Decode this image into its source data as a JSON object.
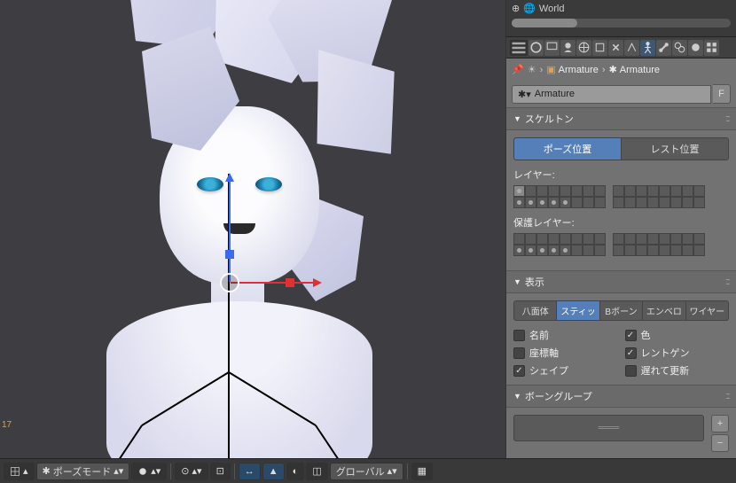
{
  "outliner": {
    "world": "World"
  },
  "breadcrumb": {
    "armature1": "Armature",
    "armature2": "Armature"
  },
  "datablock": {
    "name": "Armature",
    "fake_user": "F"
  },
  "panels": {
    "skeleton": {
      "title": "スケルトン",
      "pose_position": "ポーズ位置",
      "rest_position": "レスト位置",
      "layers_label": "レイヤー:",
      "protected_label": "保護レイヤー:"
    },
    "display": {
      "title": "表示",
      "octahedral": "八面体",
      "stick": "スティッ",
      "bbone": "Bボーン",
      "envelope": "エンベロ",
      "wire": "ワイヤー",
      "names": "名前",
      "colors": "色",
      "axes": "座標軸",
      "xray": "レントゲン",
      "shapes": "シェイプ",
      "delay": "遅れて更新"
    },
    "bonegroups": {
      "title": "ボーングループ",
      "placeholder": "═══"
    }
  },
  "viewport": {
    "frame_label": "17"
  },
  "footer": {
    "mode": "ポーズモード",
    "orientation": "グローバル"
  },
  "icons": {
    "world": "🌐",
    "armature": "👤",
    "data": "◆",
    "pin": "📌",
    "chev": "›",
    "tri_down": "▼",
    "tri_up": "▲",
    "plus": "+",
    "minus": "−",
    "cursor": "⊕"
  },
  "colors": {
    "accent": "#557fb8",
    "axis_x": "#e03030",
    "axis_z": "#3a6af0"
  }
}
